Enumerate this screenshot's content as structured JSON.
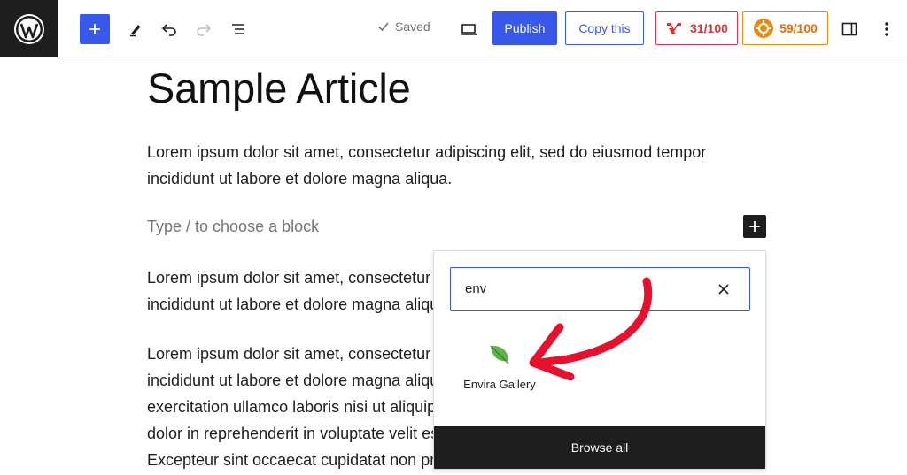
{
  "toolbar": {
    "saved_label": "Saved",
    "publish_label": "Publish",
    "copy_label": "Copy this",
    "seo_score": "31/100",
    "readability_score": "59/100"
  },
  "post": {
    "title": "Sample Article",
    "paragraph1": "Lorem ipsum dolor sit amet, consectetur adipiscing elit, sed do eiusmod tempor incididunt ut labore et dolore magna aliqua.",
    "placeholder": "Type / to choose a block",
    "paragraph2": "Lorem ipsum dolor sit amet, consectetur adipiscing elit, sed do eiusmod tempor incididunt ut labore et dolore magna aliqua.",
    "paragraph3": "Lorem ipsum dolor sit amet, consectetur adipiscing elit, sed do eiusmod tempor incididunt ut labore et dolore magna aliqua. Ut enim ad minim veniam, quis nostrud exercitation ullamco laboris nisi ut aliquip ex ea commodo consequat. Duis aute irure dolor in reprehenderit in voluptate velit esse cillum dolore eu fugiat nulla pariatur. Excepteur sint occaecat cupidatat non proident."
  },
  "inserter": {
    "search_value": "env",
    "result_label": "Envira Gallery",
    "browse_all_label": "Browse all"
  },
  "colors": {
    "accent": "#3858e9",
    "dark": "#1e1e1e",
    "seo_red": "#d63638",
    "readability_orange": "#e26f0a",
    "arrow_red": "#e8112d",
    "leaf_green": "#4caf50"
  }
}
